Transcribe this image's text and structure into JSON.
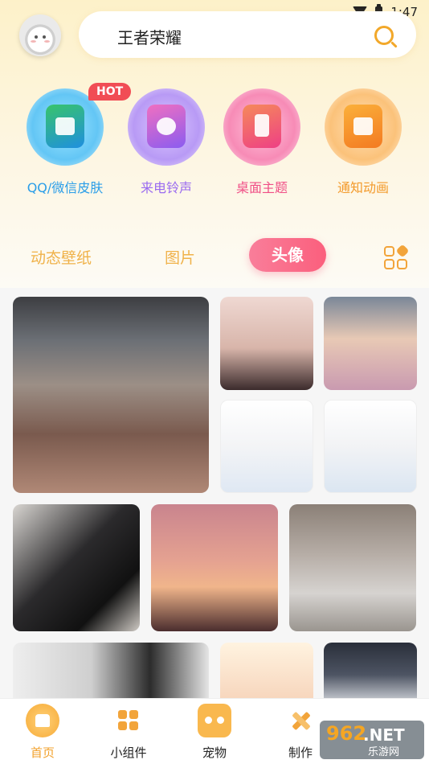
{
  "status_bar": {
    "time": "1:47"
  },
  "search": {
    "query": "王者荣耀"
  },
  "categories": [
    {
      "label": "QQ/微信皮肤",
      "icon": "shirt-icon",
      "color": "#2a9ee8"
    },
    {
      "label": "来电铃声",
      "icon": "fan-icon",
      "color": "#9a6bf0"
    },
    {
      "label": "桌面主题",
      "icon": "phone-icon",
      "color": "#f04e86"
    },
    {
      "label": "通知动画",
      "icon": "video-icon",
      "color": "#f39a2a"
    }
  ],
  "hot_badge": "HOT",
  "tabs": [
    {
      "label": "动态壁纸"
    },
    {
      "label": "图片"
    },
    {
      "label": "头像",
      "active": true
    }
  ],
  "nav": [
    {
      "label": "首页",
      "icon": "home-icon",
      "active": true
    },
    {
      "label": "小组件",
      "icon": "widgets-icon"
    },
    {
      "label": "宠物",
      "icon": "pet-icon"
    },
    {
      "label": "制作",
      "icon": "create-icon"
    }
  ],
  "watermark": {
    "brand": "962",
    "suffix": ".NET",
    "sub": "乐游网"
  },
  "colors": {
    "accent": "#f2a12c",
    "tab_active": "#fb5f7d"
  }
}
